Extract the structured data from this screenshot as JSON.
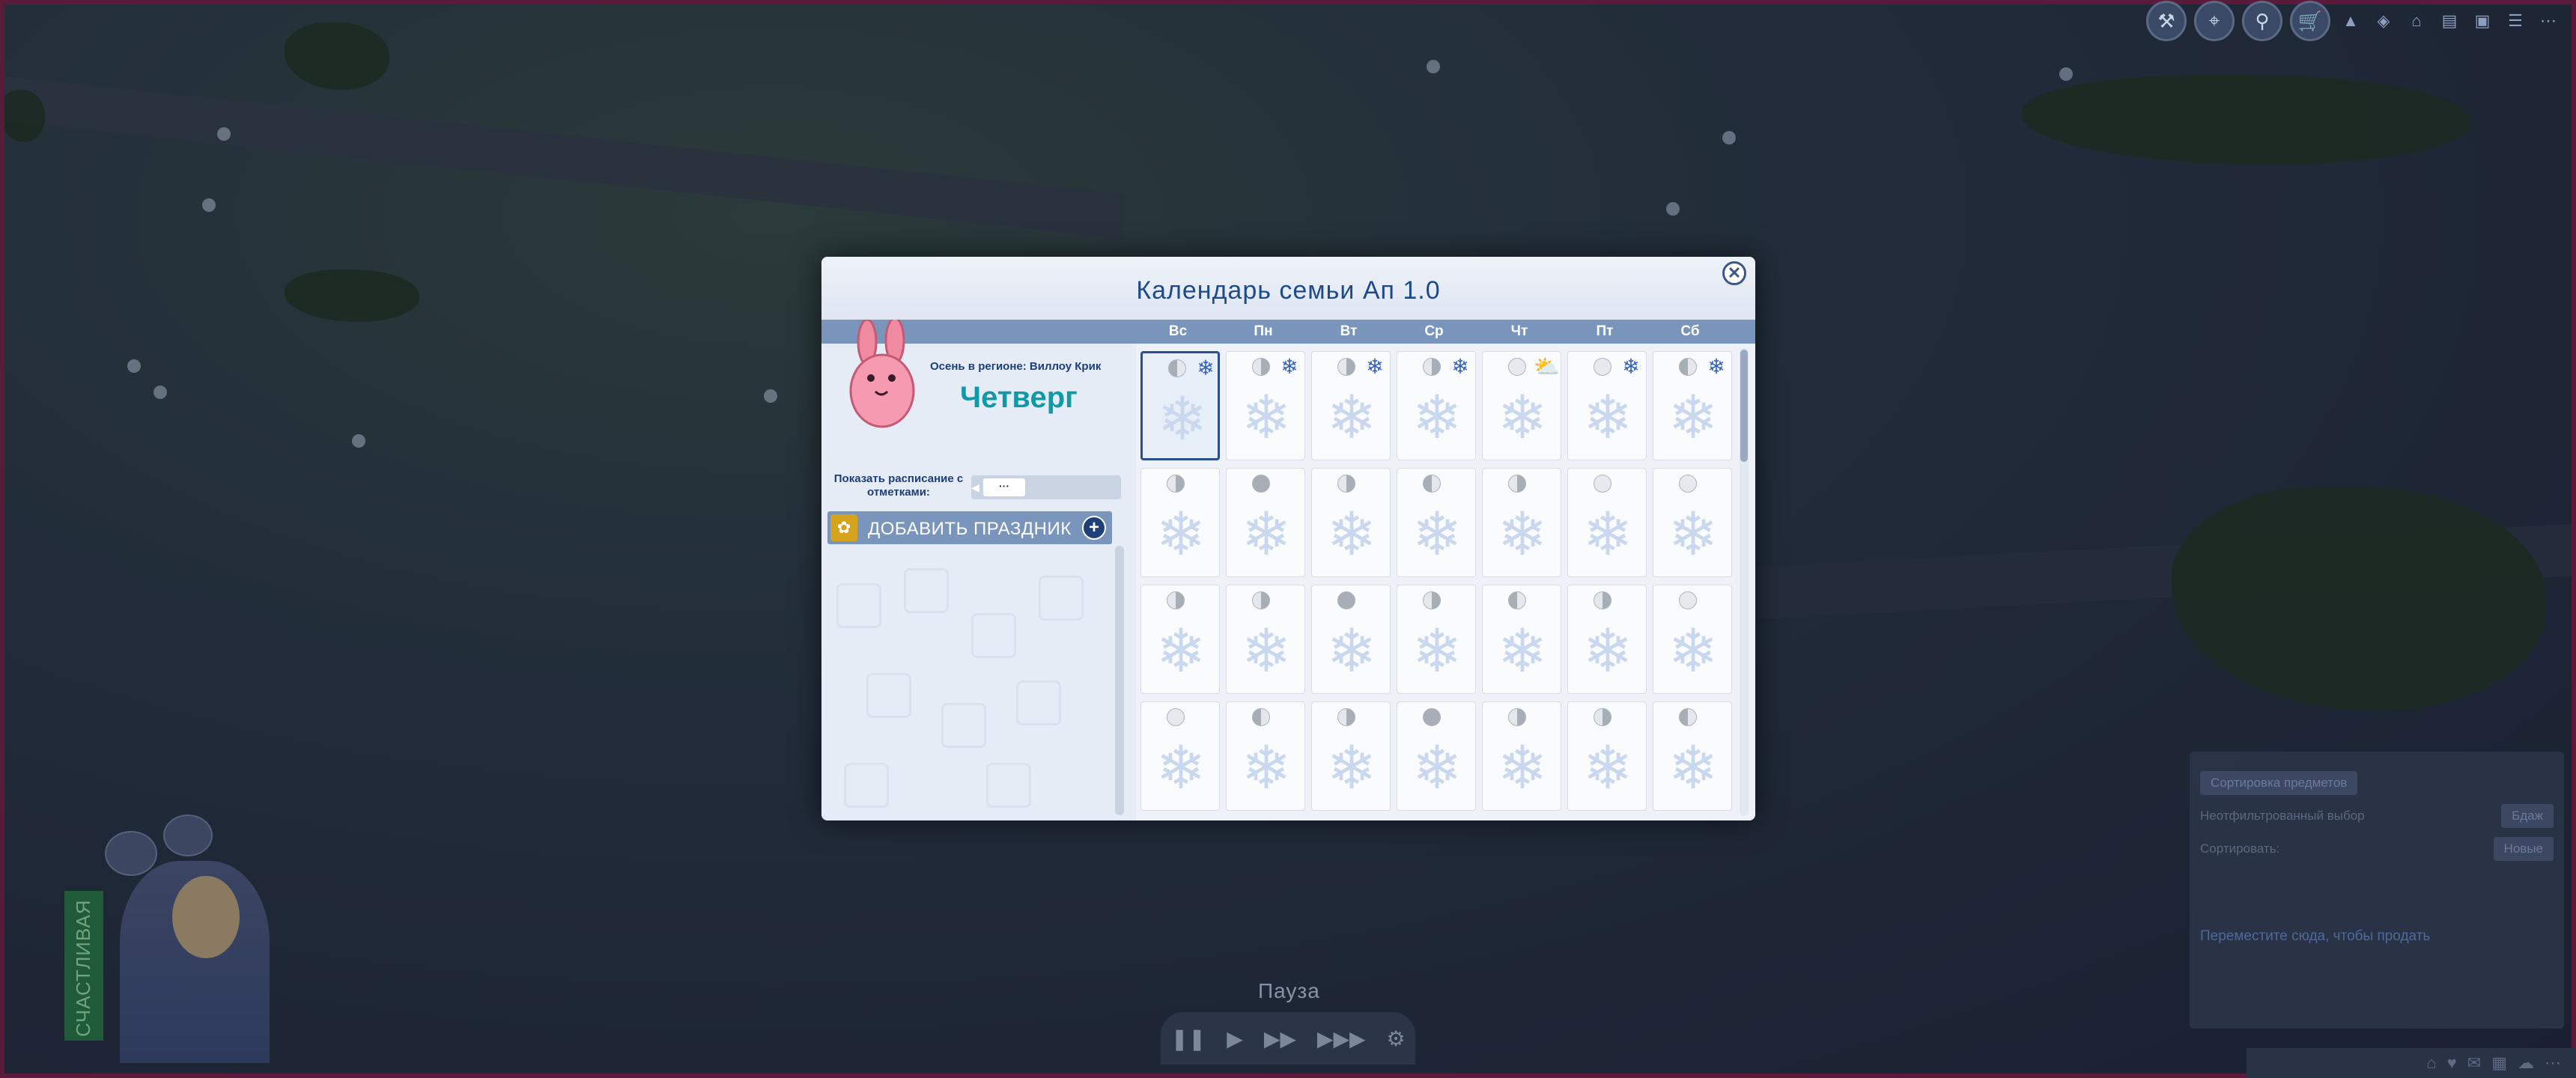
{
  "dialog": {
    "title": "Календарь семьи Ап 1.0",
    "close_label": "✕",
    "days_of_week": [
      "Вс",
      "Пн",
      "Вт",
      "Ср",
      "Чт",
      "Пт",
      "Сб"
    ],
    "season_text": "Осень в регионе: Виллоу Крик",
    "current_day": "Четверг",
    "show_schedule_label": "Показать расписание с отметками:",
    "schedule_value": "···",
    "add_holiday_label": "ДОБАВИТЬ ПРАЗДНИК",
    "add_holiday_plus": "+",
    "weeks": [
      [
        {
          "moon": "half",
          "weather": "snow",
          "today": true
        },
        {
          "moon": "halfr",
          "weather": "snow"
        },
        {
          "moon": "halfr",
          "weather": "snow"
        },
        {
          "moon": "halfr",
          "weather": "snow"
        },
        {
          "moon": "new",
          "weather": "sun"
        },
        {
          "moon": "new",
          "weather": "snow"
        },
        {
          "moon": "half",
          "weather": "snow"
        }
      ],
      [
        {
          "moon": "halfr"
        },
        {
          "moon": "full"
        },
        {
          "moon": "halfr"
        },
        {
          "moon": "half"
        },
        {
          "moon": "halfr"
        },
        {
          "moon": "new"
        },
        {
          "moon": "new"
        }
      ],
      [
        {
          "moon": "halfr"
        },
        {
          "moon": "halfr"
        },
        {
          "moon": "full"
        },
        {
          "moon": "halfr"
        },
        {
          "moon": "half"
        },
        {
          "moon": "halfr"
        },
        {
          "moon": "new"
        }
      ],
      [
        {
          "moon": "new"
        },
        {
          "moon": "half"
        },
        {
          "moon": "halfr"
        },
        {
          "moon": "full"
        },
        {
          "moon": "halfr"
        },
        {
          "moon": "halfr"
        },
        {
          "moon": "half"
        }
      ]
    ]
  },
  "hud": {
    "pause_label": "Пауза",
    "mood_label": "СЧАСТЛИВАЯ",
    "buy_panel": {
      "sort_label": "Сортировка предметов",
      "filter_label": "Неотфильтрованный выбор",
      "filter_value": "Бдаж",
      "sort_by_label": "Сортировать:",
      "sort_by_value": "Новые",
      "sell_hint": "Переместите сюда, чтобы продать"
    }
  },
  "icons": {
    "snow": "❄",
    "sun": "⛅",
    "flake_bg": "❄"
  }
}
